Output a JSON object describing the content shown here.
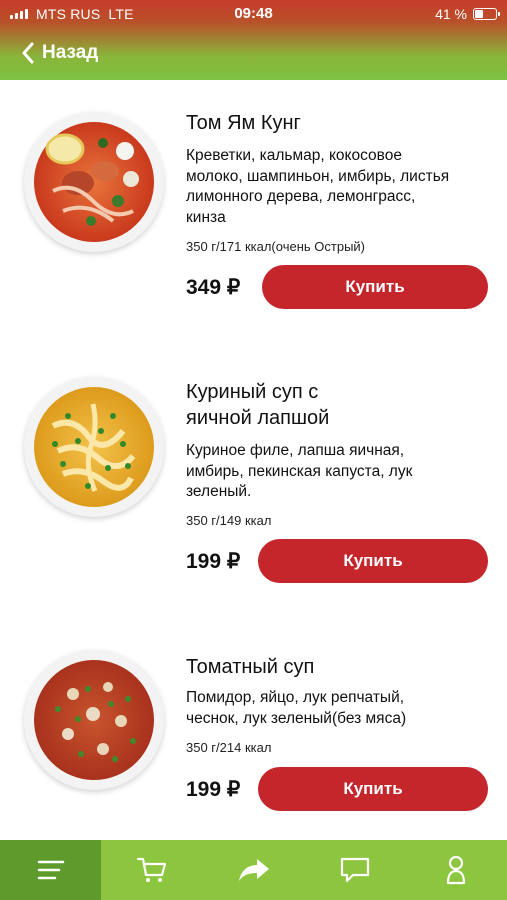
{
  "status": {
    "carrier": "MTS RUS",
    "network": "LTE",
    "time": "09:48",
    "battery_text": "41 %",
    "battery_level": 0.41
  },
  "header": {
    "back_label": "Назад"
  },
  "items": [
    {
      "title_lines": [
        "Том Ям Кунг"
      ],
      "description_lines": [
        "Креветки, кальмар, кокосовое",
        "молоко, шампиньон, имбирь, листья",
        "лимонного дерева, лемонграсс,",
        "кинза"
      ],
      "weight": "350 г/171 ккал(очень Острый)",
      "price": "349 ₽",
      "buy_label": "Купить"
    },
    {
      "title_lines": [
        "Куриный суп с",
        "яичной лапшой"
      ],
      "description_lines": [
        "Куриное филе, лапша яичная,",
        "имбирь, пекинская капуста, лук",
        "зеленый."
      ],
      "weight": "350 г/149 ккал",
      "price": "199 ₽",
      "buy_label": "Купить"
    },
    {
      "title_lines": [
        "Томатный суп"
      ],
      "description_lines": [
        "Помидор, яйцо, лук репчатый,",
        "чеснок, лук зеленый(без мяса)"
      ],
      "weight": "350 г/214 ккал",
      "price": "199 ₽",
      "buy_label": "Купить"
    }
  ],
  "nav": [
    {
      "icon": "menu-icon",
      "active": true
    },
    {
      "icon": "cart-icon",
      "active": false
    },
    {
      "icon": "share-icon",
      "active": false
    },
    {
      "icon": "chat-icon",
      "active": false
    },
    {
      "icon": "profile-icon",
      "active": false
    }
  ],
  "colors": {
    "buy_button": "#c4262b",
    "nav_bar": "#8cc63f",
    "nav_active": "#5f9a2c"
  }
}
